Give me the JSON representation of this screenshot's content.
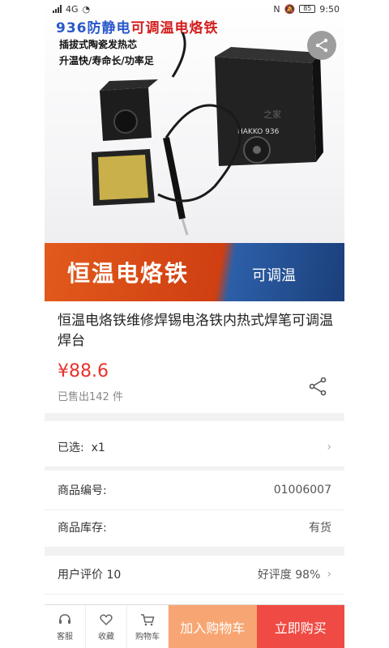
{
  "status_bar": {
    "signal_text": "4G",
    "battery": "85",
    "time": "9:50"
  },
  "hero": {
    "title_blue": "936",
    "title_mid": "防静电",
    "title_red": "可调温电烙铁",
    "line1": "插拔式陶瓷发热芯",
    "line2": "升温快/寿命长/功率足",
    "banner_big": "恒温电烙铁",
    "banner_small": "可调温",
    "device_label": "HAKKO 936",
    "watermark": "之家"
  },
  "product": {
    "title": "恒温电烙铁维修焊锡电洛铁内热式焊笔可调温焊台",
    "price": "¥88.6",
    "sold": "已售出142 件"
  },
  "rows": {
    "selected_label": "已选:",
    "selected_value": "x1",
    "code_label": "商品编号:",
    "code_value": "01006007",
    "stock_label": "商品库存:",
    "stock_value": "有货",
    "review_label": "用户评价 10",
    "review_value": "好评度 98%"
  },
  "bottom_bar": {
    "service": "客服",
    "favorite": "收藏",
    "cart": "购物车",
    "add_to_cart": "加入购物车",
    "buy_now": "立即购买"
  },
  "colors": {
    "price": "#e8332f",
    "buy": "#ef4a43",
    "cart": "#f7a673"
  }
}
